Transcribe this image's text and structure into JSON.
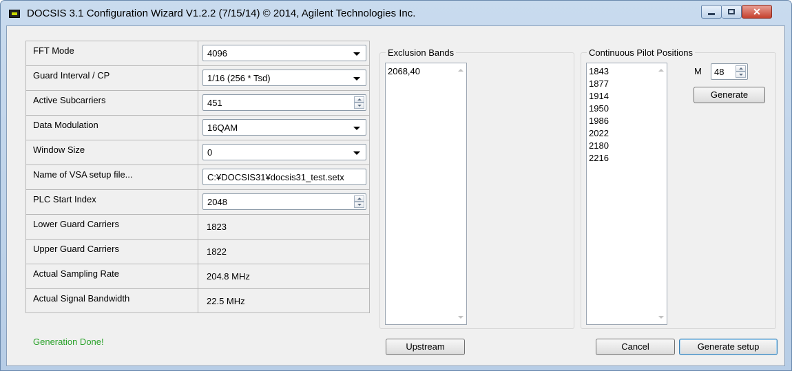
{
  "window": {
    "title": "DOCSIS 3.1 Configuration Wizard V1.2.2 (7/15/14)  © 2014, Agilent Technologies Inc.",
    "close_glyph": "✕"
  },
  "params": {
    "fft_mode": {
      "label": "FFT Mode",
      "value": "4096"
    },
    "guard_interval": {
      "label": "Guard Interval / CP",
      "value": "1/16 (256 * Tsd)"
    },
    "active_subcarriers": {
      "label": "Active Subcarriers",
      "value": "451"
    },
    "data_modulation": {
      "label": "Data Modulation",
      "value": "16QAM"
    },
    "window_size": {
      "label": "Window Size",
      "value": "0"
    },
    "vsa_file": {
      "label": "Name of VSA setup file...",
      "value": "C:¥DOCSIS31¥docsis31_test.setx"
    },
    "plc_start": {
      "label": "PLC Start Index",
      "value": "2048"
    },
    "lower_guard": {
      "label": "Lower Guard Carriers",
      "value": "1823"
    },
    "upper_guard": {
      "label": "Upper Guard Carriers",
      "value": "1822"
    },
    "sampling_rate": {
      "label": "Actual Sampling Rate",
      "value": "204.8 MHz"
    },
    "signal_bandwidth": {
      "label": "Actual Signal Bandwidth",
      "value": "22.5 MHz"
    }
  },
  "status": {
    "text": "Generation Done!",
    "color": "#2ba22b"
  },
  "exclusion": {
    "title": "Exclusion Bands",
    "items": [
      "2068,40"
    ],
    "upstream_label": "Upstream"
  },
  "pilots": {
    "title": "Continuous Pilot Positions",
    "items": [
      "1843",
      "1877",
      "1914",
      "1950",
      "1986",
      "2022",
      "2180",
      "2216"
    ],
    "m_label": "M",
    "m_value": "48",
    "generate_label": "Generate"
  },
  "footer": {
    "cancel_label": "Cancel",
    "generate_setup_label": "Generate setup"
  }
}
